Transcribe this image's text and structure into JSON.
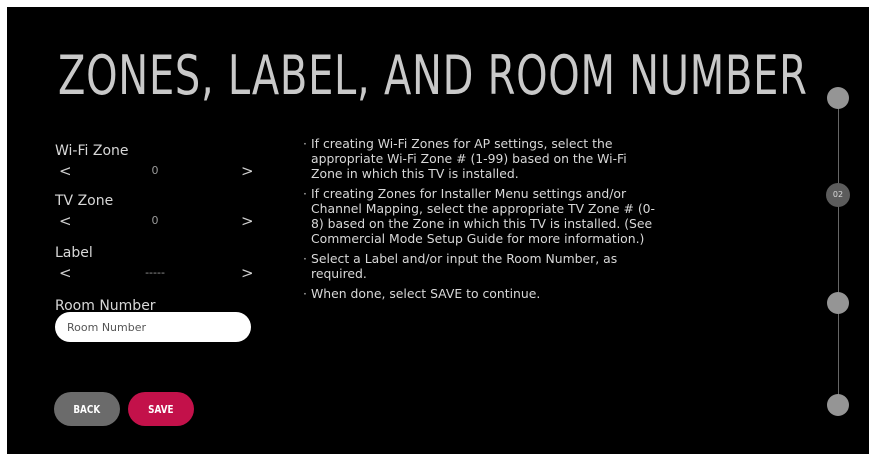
{
  "title": "ZONES, LABEL, AND ROOM NUMBER",
  "fields": {
    "wifi_zone": {
      "label": "Wi-Fi Zone",
      "value": "0",
      "prev": "<",
      "next": ">"
    },
    "tv_zone": {
      "label": "TV Zone",
      "value": "0",
      "prev": "<",
      "next": ">"
    },
    "label": {
      "label": "Label",
      "value": "-----",
      "prev": "<",
      "next": ">"
    },
    "room_number": {
      "label": "Room Number",
      "value": "",
      "placeholder": "Room Number"
    }
  },
  "instructions": [
    "If creating Wi-Fi Zones for AP settings, select the appropriate Wi-Fi Zone # (1-99) based on the Wi-Fi Zone in which this TV is installed.",
    "If creating Zones for Installer Menu settings and/or Channel Mapping, select the appropriate TV Zone # (0-8) based on the Zone in which this TV is installed. (See Commercial Mode Setup Guide for more information.)",
    "Select a Label and/or input the Room Number, as required.",
    "When done, select SAVE to continue."
  ],
  "buttons": {
    "back": "BACK",
    "save": "SAVE"
  },
  "progress": {
    "current_step": "02",
    "current_index": 2,
    "total_steps": 4
  },
  "colors": {
    "background": "#000000",
    "save_accent": "#c3114a",
    "back_button": "#6b6b6b"
  }
}
